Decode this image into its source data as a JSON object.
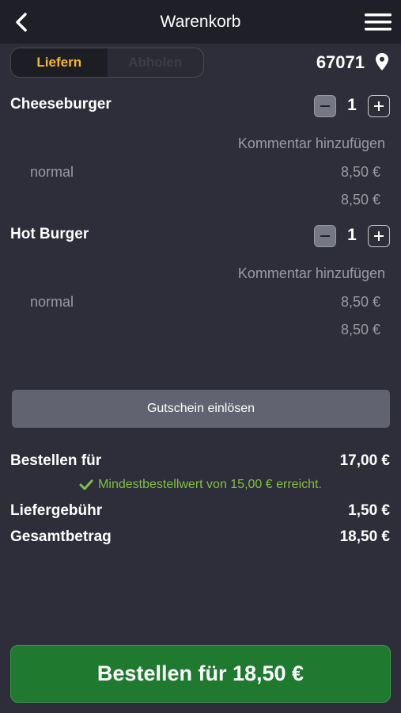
{
  "header": {
    "title": "Warenkorb"
  },
  "delivery_mode": {
    "options": [
      "Liefern",
      "Abholen"
    ],
    "selected": "Liefern"
  },
  "location": {
    "postal_code": "67071"
  },
  "cart": {
    "items": [
      {
        "name": "Cheeseburger",
        "quantity": "1",
        "comment_label": "Kommentar hinzufügen",
        "variant": "normal",
        "variant_price": "8,50 €",
        "line_total": "8,50 €"
      },
      {
        "name": "Hot Burger",
        "quantity": "1",
        "comment_label": "Kommentar hinzufügen",
        "variant": "normal",
        "variant_price": "8,50 €",
        "line_total": "8,50 €"
      }
    ]
  },
  "voucher": {
    "label": "Gutschein einlösen"
  },
  "summary": {
    "subtotal_label": "Bestellen für",
    "subtotal_value": "17,00 €",
    "min_order_note": "Mindestbestellwert von 15,00 € erreicht.",
    "delivery_fee_label": "Liefergebühr",
    "delivery_fee_value": "1,50 €",
    "total_label": "Gesamtbetrag",
    "total_value": "18,50 €"
  },
  "order_button": {
    "label": "Bestellen für 18,50 €"
  },
  "colors": {
    "background": "#2e2d3a",
    "accent": "#f5b82e",
    "success": "#7fc241",
    "order_button": "#1f7a2f"
  },
  "icons": {
    "back": "chevron-left-icon",
    "menu": "hamburger-menu-icon",
    "location": "map-pin-icon",
    "check": "checkmark-icon"
  }
}
